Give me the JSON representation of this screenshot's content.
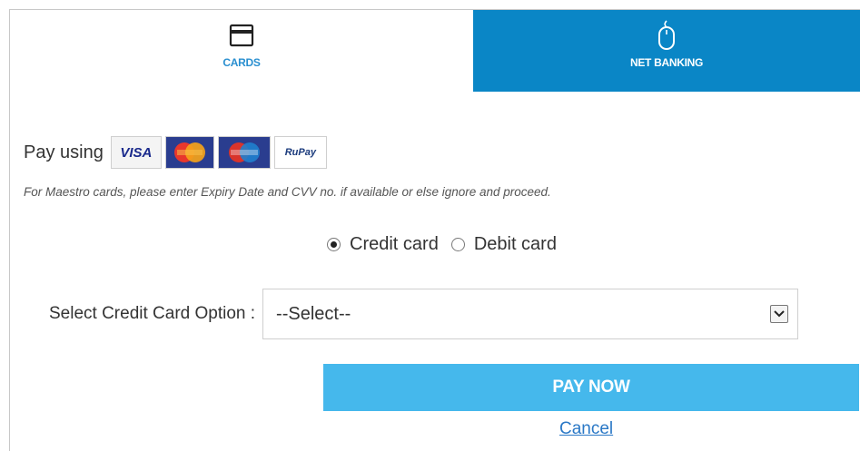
{
  "tabs": [
    {
      "label": "CARDS",
      "icon": "card-icon",
      "active": true
    },
    {
      "label": "NET BANKING",
      "icon": "mouse-icon",
      "active": false
    }
  ],
  "pay_using": {
    "label": "Pay using",
    "logos": [
      "VISA",
      "MasterCard",
      "Maestro",
      "RuPay"
    ]
  },
  "note": "For Maestro cards, please enter Expiry Date and CVV no. if available or else ignore and proceed.",
  "card_type": {
    "options": [
      {
        "label": "Credit card",
        "selected": true
      },
      {
        "label": "Debit card",
        "selected": false
      }
    ]
  },
  "select": {
    "label": "Select Credit Card Option :",
    "value": "--Select--"
  },
  "actions": {
    "pay_now": "PAY NOW",
    "cancel": "Cancel"
  },
  "colors": {
    "accent_blue": "#0a86c6",
    "button_blue": "#45b8ec",
    "link_blue": "#2a78c6"
  }
}
